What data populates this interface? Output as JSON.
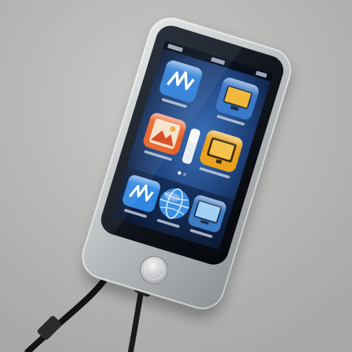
{
  "scene": {
    "background_color": "#b8b8b6",
    "device_body_color": "#c9cbcc",
    "screen_color": "#0b1220",
    "cable_color": "#1a1a1a"
  },
  "device": {
    "status_bar": {
      "carrier": "",
      "time": ""
    },
    "apps": [
      {
        "icon": "audio-wave-icon",
        "label": "",
        "color": "#2f7fd8"
      },
      {
        "icon": "monitor-icon",
        "label": "",
        "color": "#3a78c8"
      },
      {
        "icon": "photo-icon",
        "label": "",
        "color": "#e8622a"
      },
      {
        "icon": "tv-icon",
        "label": "",
        "color": "#e8a21e"
      },
      {
        "icon": "audio-wave-icon",
        "label": "",
        "color": "#2f86e0"
      },
      {
        "icon": "globe-icon",
        "label": "",
        "color": "#3b8fe0"
      },
      {
        "icon": "desktop-icon",
        "label": "",
        "color": "#3c7cc4"
      }
    ]
  }
}
